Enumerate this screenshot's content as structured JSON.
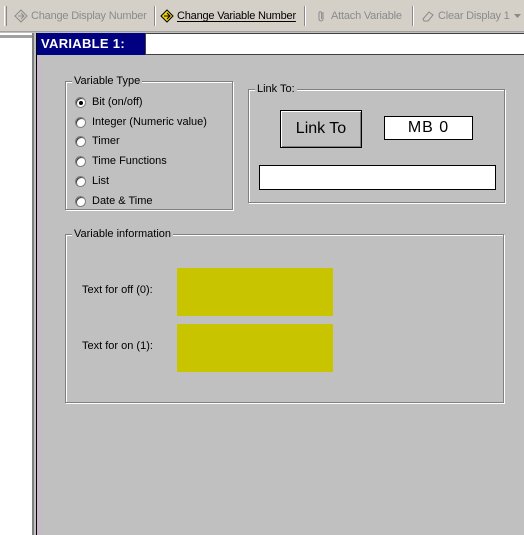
{
  "toolbar": {
    "change_display": "Change Display Number",
    "change_variable": "Change Variable Number",
    "attach_variable": "Attach Variable",
    "clear_display": "Clear Display 1"
  },
  "panel": {
    "title": "VARIABLE 1:",
    "title_value": ""
  },
  "variable_type": {
    "label": "Variable Type",
    "options": [
      "Bit (on/off)",
      "Integer (Numeric value)",
      "Timer",
      "Time Functions",
      "List",
      "Date & Time"
    ],
    "selected_index": 0
  },
  "link_to": {
    "label": "Link To:",
    "button_label": "Link To",
    "address_value": "MB  0",
    "link_text_value": ""
  },
  "variable_info": {
    "label": "Variable information",
    "text_off_label": "Text for off (0):",
    "text_on_label": "Text for on (1):",
    "text_off_value": "",
    "text_on_value": "",
    "box_color": "#c8c400"
  }
}
